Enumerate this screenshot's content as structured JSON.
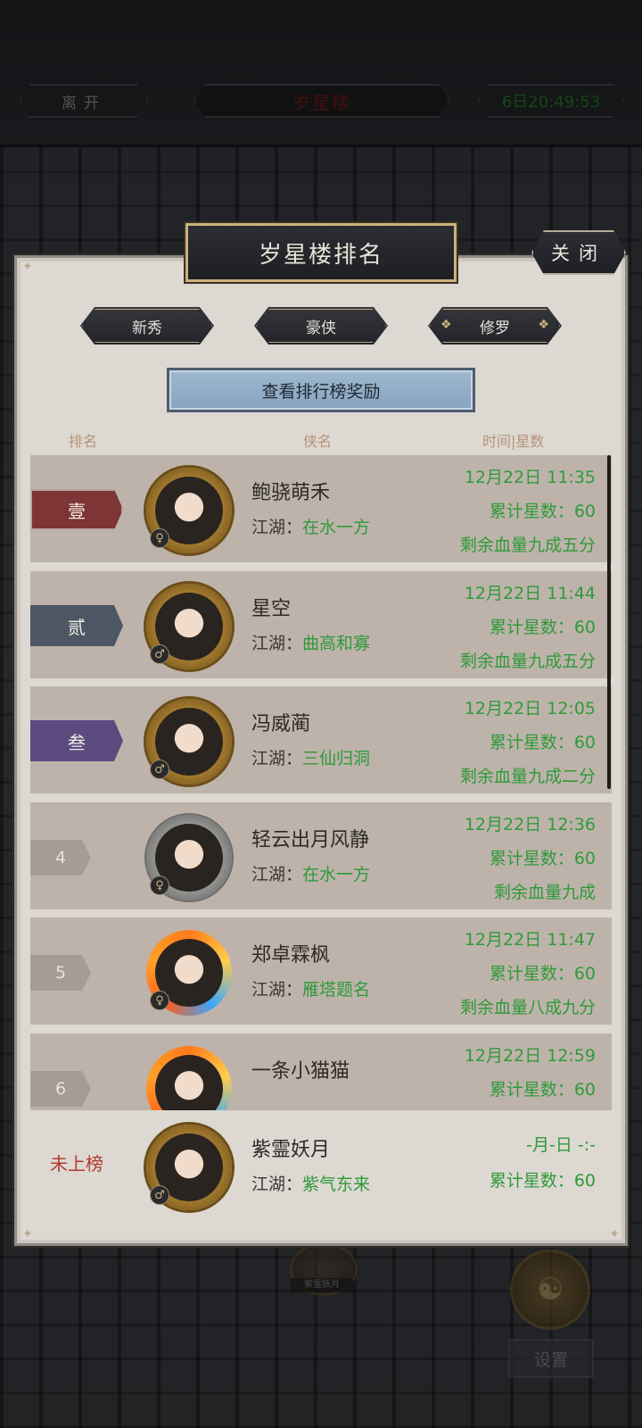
{
  "topbar": {
    "leave_label": "离开",
    "title": "岁星楼",
    "timer": "6日20:49:53"
  },
  "panel": {
    "title": "岁星楼排名",
    "close_label": "关闭",
    "tabs": [
      {
        "label": "新秀"
      },
      {
        "label": "豪侠"
      },
      {
        "label": "修罗",
        "selected": true
      }
    ],
    "reward_button": "查看排行榜奖励",
    "columns": {
      "rank": "排名",
      "name": "侠名",
      "time": "时间|星数"
    }
  },
  "rows": [
    {
      "rank": "壹",
      "name": "鲍骁萌禾",
      "gang_label": "江湖：",
      "gang": "在水一方",
      "time": "12月22日 11:35",
      "stars": "累计星数：60",
      "hp": "剩余血量九成五分",
      "gender": "♀"
    },
    {
      "rank": "贰",
      "name": "星空",
      "gang_label": "江湖：",
      "gang": "曲高和寡",
      "time": "12月22日 11:44",
      "stars": "累计星数：60",
      "hp": "剩余血量九成五分",
      "gender": "♂"
    },
    {
      "rank": "叁",
      "name": "冯威蔺",
      "gang_label": "江湖：",
      "gang": "三仙归洞",
      "time": "12月22日 12:05",
      "stars": "累计星数：60",
      "hp": "剩余血量九成二分",
      "gender": "♂"
    },
    {
      "rank": "4",
      "name": "轻云出月风静",
      "gang_label": "江湖：",
      "gang": "在水一方",
      "time": "12月22日 12:36",
      "stars": "累计星数：60",
      "hp": "剩余血量九成",
      "gender": "♀"
    },
    {
      "rank": "5",
      "name": "郑卓霖枫",
      "gang_label": "江湖：",
      "gang": "雁塔题名",
      "time": "12月22日 11:47",
      "stars": "累计星数：60",
      "hp": "剩余血量八成九分",
      "gender": "♀"
    },
    {
      "rank": "6",
      "name": "一条小猫猫",
      "time": "12月22日 12:59",
      "stars": "累计星数：60"
    }
  ],
  "self_row": {
    "rank": "未上榜",
    "name": "紫霊妖月",
    "gang_label": "江湖：",
    "gang": "紫气东来",
    "time": "-月-日 -:-",
    "stars": "累计星数：60",
    "gender": "♂"
  },
  "background": {
    "avatar_name": "紫霊妖月",
    "settings_label": "设置"
  },
  "colors": {
    "green_text": "#2f9a3a",
    "rank1": "#7d3535",
    "rank2": "#4d5763",
    "rank3": "#5a4a7d",
    "not_ranked": "#b23a2e"
  }
}
